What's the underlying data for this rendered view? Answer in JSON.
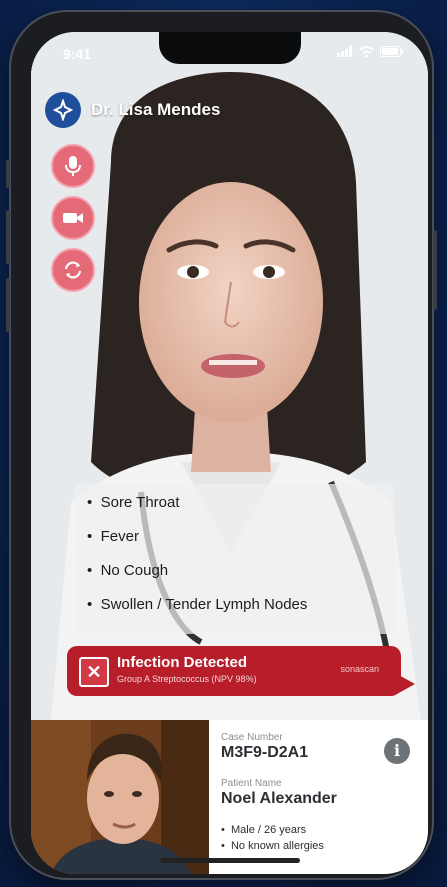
{
  "status_bar": {
    "time": "9:41"
  },
  "header": {
    "doctor_name": "Dr. Lisa Mendes"
  },
  "symptoms": [
    "Sore Throat",
    "Fever",
    "No Cough",
    "Swollen / Tender Lymph Nodes"
  ],
  "alert": {
    "title": "Infection Detected",
    "subtitle": "Group A Streptococcus (NPV 98%)",
    "brand": "sonascan"
  },
  "patient": {
    "case_label": "Case Number",
    "case_number": "M3F9-D2A1",
    "name_label": "Patient Name",
    "name": "Noel Alexander",
    "details": [
      "Male / 26 years",
      "No known allergies"
    ]
  },
  "colors": {
    "alert_red": "#b81e2a",
    "control_pink": "#e46a77",
    "logo_blue": "#1f4f9c"
  },
  "icons": [
    "logo-icon",
    "microphone-icon",
    "camera-icon",
    "switch-camera-icon",
    "close-icon",
    "info-icon"
  ]
}
